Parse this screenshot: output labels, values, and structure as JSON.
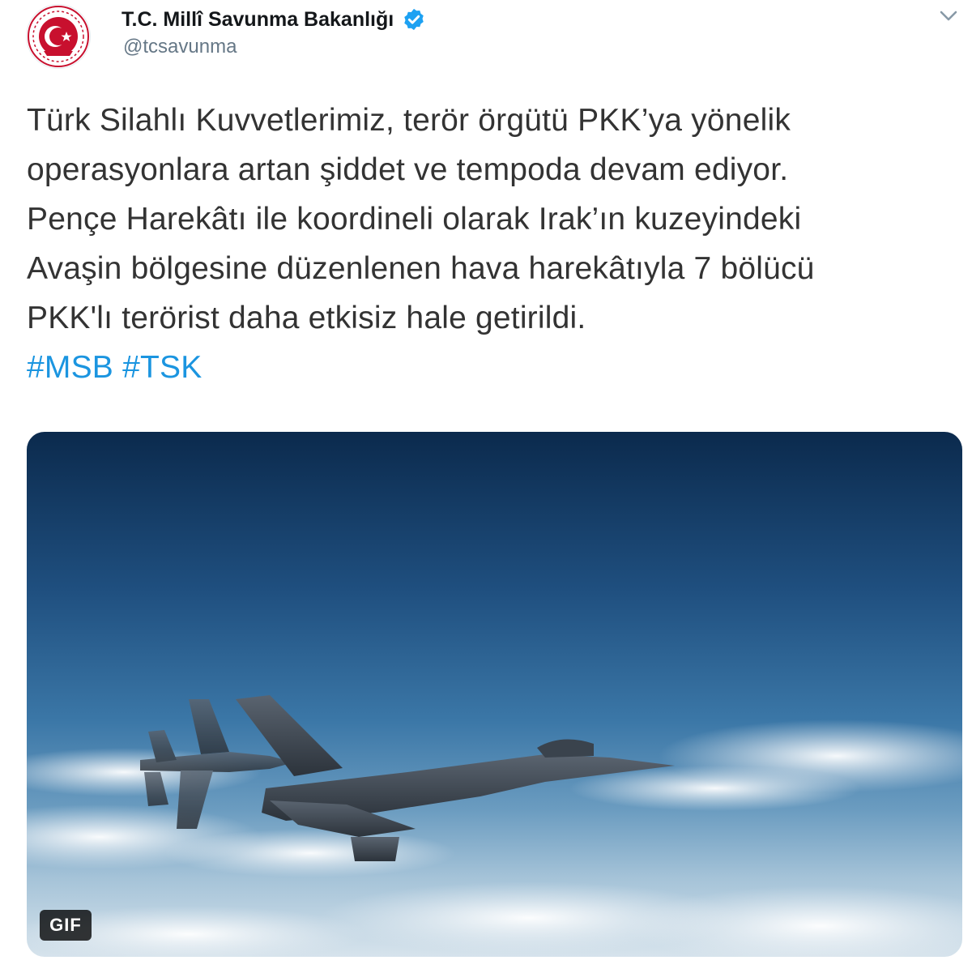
{
  "tweet": {
    "author": {
      "display_name": "T.C. Millî Savunma Bakanlığı",
      "handle": "@tcsavunma",
      "verified": true,
      "avatar_icon": "ministry-emblem-icon",
      "verified_icon": "verified-badge-icon"
    },
    "menu_icon": "chevron-down-icon",
    "text_lines": [
      "Türk Silahlı Kuvvetlerimiz, terör örgütü PKK’ya yönelik",
      "operasyonlara artan şiddet ve tempoda devam ediyor.",
      "Pençe Harekâtı ile koordineli olarak Irak’ın kuzeyindeki",
      "Avaşin bölgesine düzenlenen hava harekâtıyla 7 bölücü",
      "PKK'lı terörist daha etkisiz hale getirildi."
    ],
    "hashtags": [
      "#MSB",
      "#TSK"
    ],
    "media": {
      "type": "gif",
      "badge_label": "GIF"
    },
    "colors": {
      "link": "#1b95e0",
      "verified": "#1da1f2",
      "emblem_red": "#c8102e",
      "text": "#333333"
    }
  }
}
